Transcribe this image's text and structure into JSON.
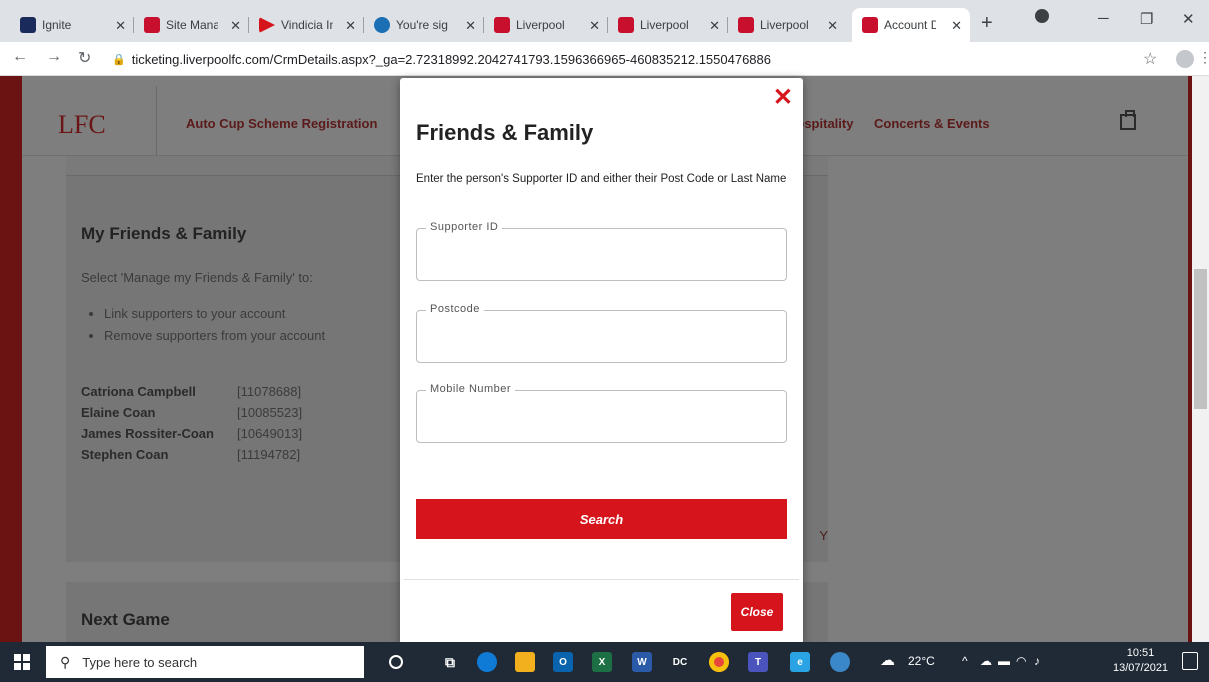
{
  "browser": {
    "tabs": [
      {
        "title": "Ignite",
        "color": "#1a2a5a"
      },
      {
        "title": "Site Manag",
        "color": "#c8102e"
      },
      {
        "title": "Vindicia Int",
        "color": "#d6141c"
      },
      {
        "title": "You're signe",
        "color": "#1b6fb5"
      },
      {
        "title": "Liverpool S",
        "color": "#c8102e"
      },
      {
        "title": "Liverpool S",
        "color": "#c8102e"
      },
      {
        "title": "Liverpool S",
        "color": "#c8102e"
      },
      {
        "title": "Account De",
        "color": "#c8102e"
      }
    ],
    "url": "ticketing.liverpoolfc.com/CrmDetails.aspx?_ga=2.72318992.2042741793.1596366965-460835212.1550476886"
  },
  "site": {
    "logo": "LFC",
    "nav": [
      "Auto Cup Scheme Registration",
      "Hospitality",
      "Concerts & Events"
    ]
  },
  "friends_card": {
    "title": "My Friends & Family",
    "intro": "Select 'Manage my Friends & Family' to:",
    "bullets": [
      "Link supporters to your account",
      "Remove supporters from your account"
    ],
    "friends": [
      {
        "name": "Catriona Campbell",
        "id": "[11078688]"
      },
      {
        "name": "Elaine Coan",
        "id": "[10085523]"
      },
      {
        "name": "James Rossiter-Coan",
        "id": "[10649013]"
      },
      {
        "name": "Stephen Coan",
        "id": "[11194782]"
      }
    ],
    "manage_fragment": "Y"
  },
  "next_game": {
    "title": "Next Game"
  },
  "modal": {
    "close_x": "✕",
    "title": "Friends & Family",
    "instruction": "Enter the person's Supporter ID and either their Post Code or Last Name",
    "fields": [
      {
        "label": "Supporter ID",
        "value": ""
      },
      {
        "label": "Postcode",
        "value": ""
      },
      {
        "label": "Mobile Number",
        "value": ""
      }
    ],
    "search_label": "Search",
    "close_label": "Close"
  },
  "taskbar": {
    "search_placeholder": "Type here to search",
    "weather": "22°C",
    "time": "10:51",
    "date": "13/07/2021"
  },
  "colors": {
    "accent": "#d6141c",
    "overlay": "#7e7e7e"
  }
}
